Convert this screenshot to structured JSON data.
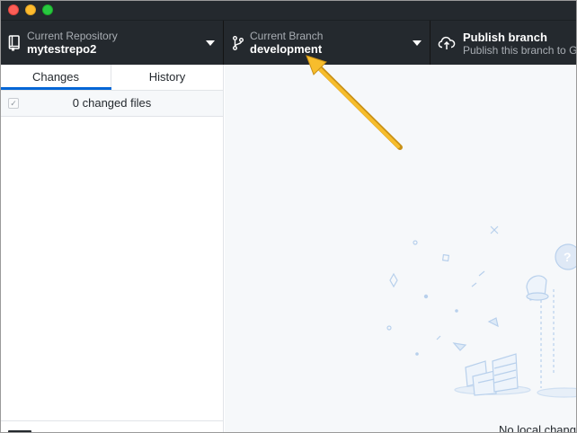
{
  "toolbar": {
    "repository": {
      "label": "Current Repository",
      "value": "mytestrepo2"
    },
    "branch": {
      "label": "Current Branch",
      "value": "development"
    },
    "publish": {
      "label": "Publish branch",
      "description": "Publish this branch to GitHub"
    }
  },
  "sidebar": {
    "tabs": [
      {
        "label": "Changes",
        "selected": true
      },
      {
        "label": "History",
        "selected": false
      }
    ],
    "changes_summary": "0 changed files",
    "select_all_checked": true
  },
  "main": {
    "message": "No local changes"
  },
  "colors": {
    "toolbar_bg": "#24292e",
    "tab_active": "#0366d6",
    "annotation_arrow": "#f0b323"
  }
}
